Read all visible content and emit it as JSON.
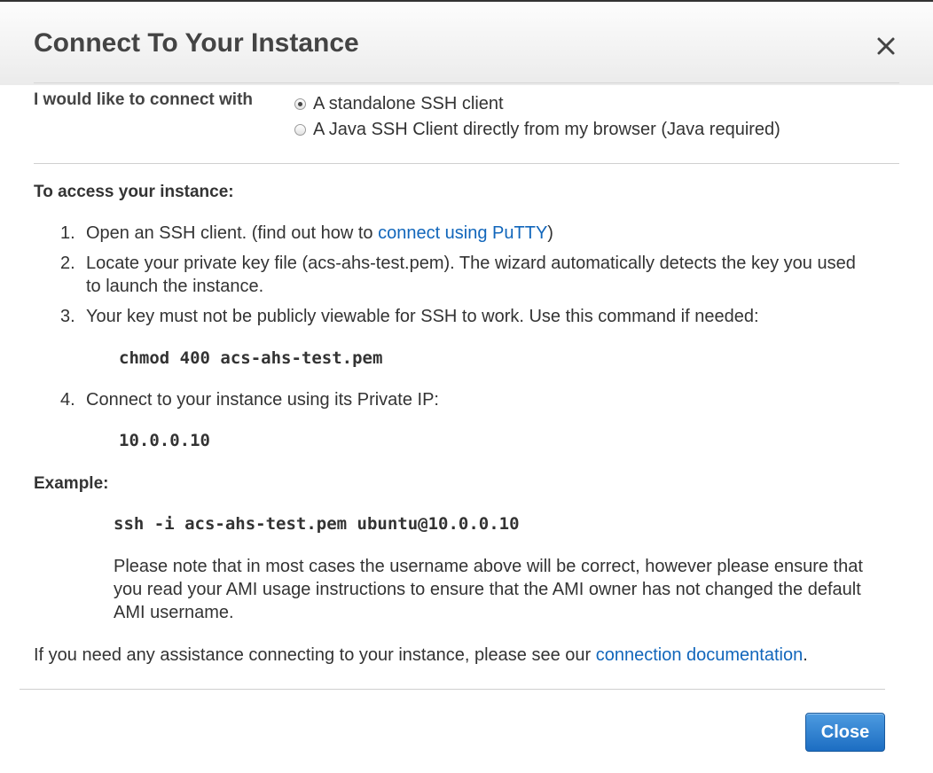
{
  "dialog": {
    "title": "Connect To Your Instance",
    "close_icon": "close-icon"
  },
  "connect": {
    "label": "I would like to connect with",
    "options": [
      {
        "label": "A standalone SSH client",
        "selected": true
      },
      {
        "label": "A Java SSH Client directly from my browser (Java required)",
        "selected": false
      }
    ]
  },
  "access": {
    "heading": "To access your instance:",
    "steps": [
      {
        "num": "1.",
        "before": "Open an SSH client. (find out how to ",
        "link": "connect using PuTTY",
        "after": ")"
      },
      {
        "num": "2.",
        "text": "Locate your private key file (acs-ahs-test.pem). The wizard automatically detects the key you used to launch the instance."
      },
      {
        "num": "3.",
        "text": "Your key must not be publicly viewable for SSH to work. Use this command if needed:",
        "code": "chmod 400 acs-ahs-test.pem"
      },
      {
        "num": "4.",
        "text": "Connect to your instance using its Private IP:",
        "code": "10.0.0.10"
      }
    ]
  },
  "example": {
    "heading": "Example:",
    "command": "ssh -i acs-ahs-test.pem ubuntu@10.0.0.10",
    "note": "Please note that in most cases the username above will be correct, however please ensure that you read your AMI usage instructions to ensure that the AMI owner has not changed the default AMI username."
  },
  "assistance": {
    "before": "If you need any assistance connecting to your instance, please see our ",
    "link": "connection documentation",
    "after": "."
  },
  "footer": {
    "close_label": "Close"
  },
  "colors": {
    "link": "#1166bb",
    "primary_button": "#1c6dc2"
  }
}
